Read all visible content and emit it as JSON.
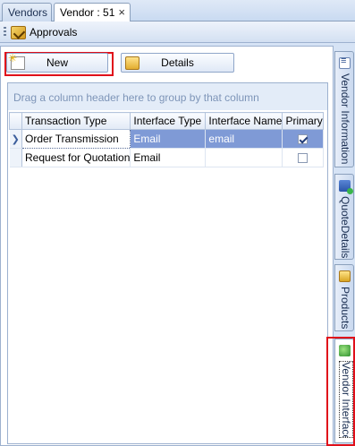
{
  "tabs": [
    {
      "label": "Vendors",
      "active": false
    },
    {
      "label": "Vendor : 51",
      "active": true,
      "close": "×"
    }
  ],
  "toolbar": {
    "approvals_label": "Approvals"
  },
  "buttons": {
    "new_label": "New",
    "details_label": "Details"
  },
  "grid": {
    "group_hint": "Drag a column header here to group by that column",
    "columns": [
      "Transaction Type",
      "Interface Type",
      "Interface Name",
      "Primary"
    ],
    "rows": [
      {
        "transaction_type": "Order Transmission",
        "interface_type": "Email",
        "interface_name": "email",
        "primary": true,
        "selected": true
      },
      {
        "transaction_type": "Request for Quotation",
        "interface_type": "Email",
        "interface_name": "",
        "primary": false,
        "selected": false
      }
    ]
  },
  "side_tabs": [
    {
      "label": "Vendor Information",
      "icon": "vendor-info-icon"
    },
    {
      "label": "QuoteDetails",
      "icon": "quote-details-icon"
    },
    {
      "label": "Products",
      "icon": "products-icon"
    },
    {
      "label": "Vendor Interface",
      "icon": "vendor-interface-icon",
      "active": true
    }
  ],
  "colors": {
    "highlight": "#e0101a",
    "selection": "#7f9ad6",
    "group_hint_text": "#7e95b8"
  }
}
